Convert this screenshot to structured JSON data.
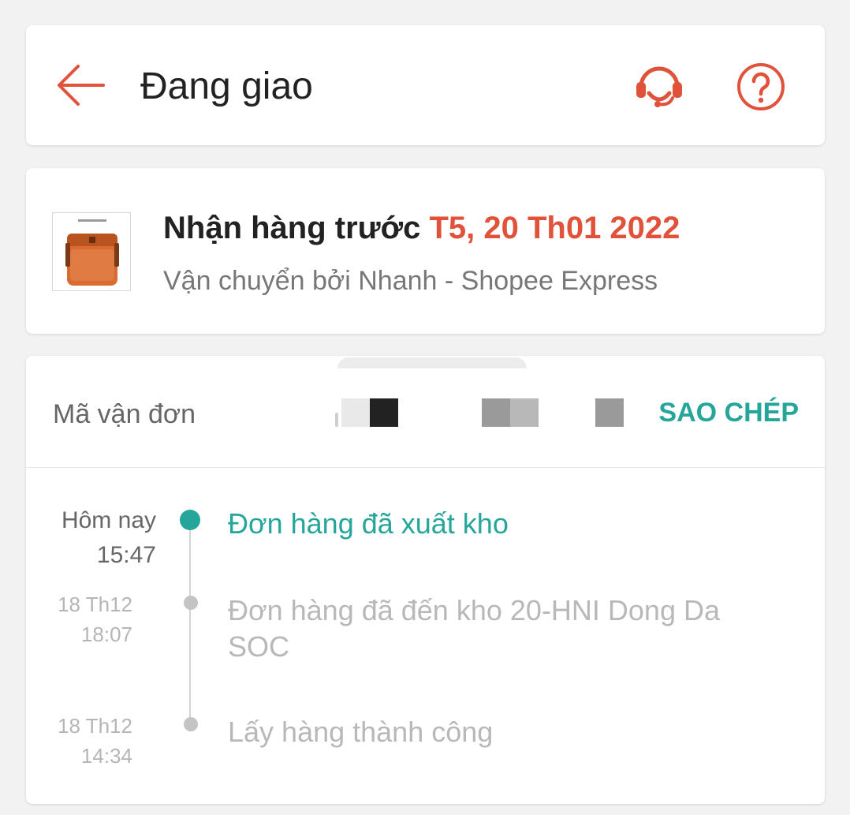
{
  "header": {
    "title": "Đang giao",
    "back_icon": "arrow-left-icon",
    "support_icon": "headset-icon",
    "help_icon": "question-circle-icon",
    "accent_color": "#e0523a"
  },
  "delivery": {
    "prefix": "Nhận hàng trước",
    "date": "T5, 20 Th01 2022",
    "carrier": "Vận chuyển bởi Nhanh - Shopee Express"
  },
  "tracking": {
    "label": "Mã vận đơn",
    "copy_label": "SAO CHÉP",
    "events": [
      {
        "day": "Hôm nay",
        "time": "15:47",
        "text": "Đơn hàng đã xuất kho",
        "active": true
      },
      {
        "day": "18 Th12",
        "time": "18:07",
        "text": "Đơn hàng đã đến kho 20-HNI Dong Da SOC",
        "active": false
      },
      {
        "day": "18 Th12",
        "time": "14:34",
        "text": "Lấy hàng thành công",
        "active": false
      }
    ],
    "active_color": "#26a69a"
  }
}
